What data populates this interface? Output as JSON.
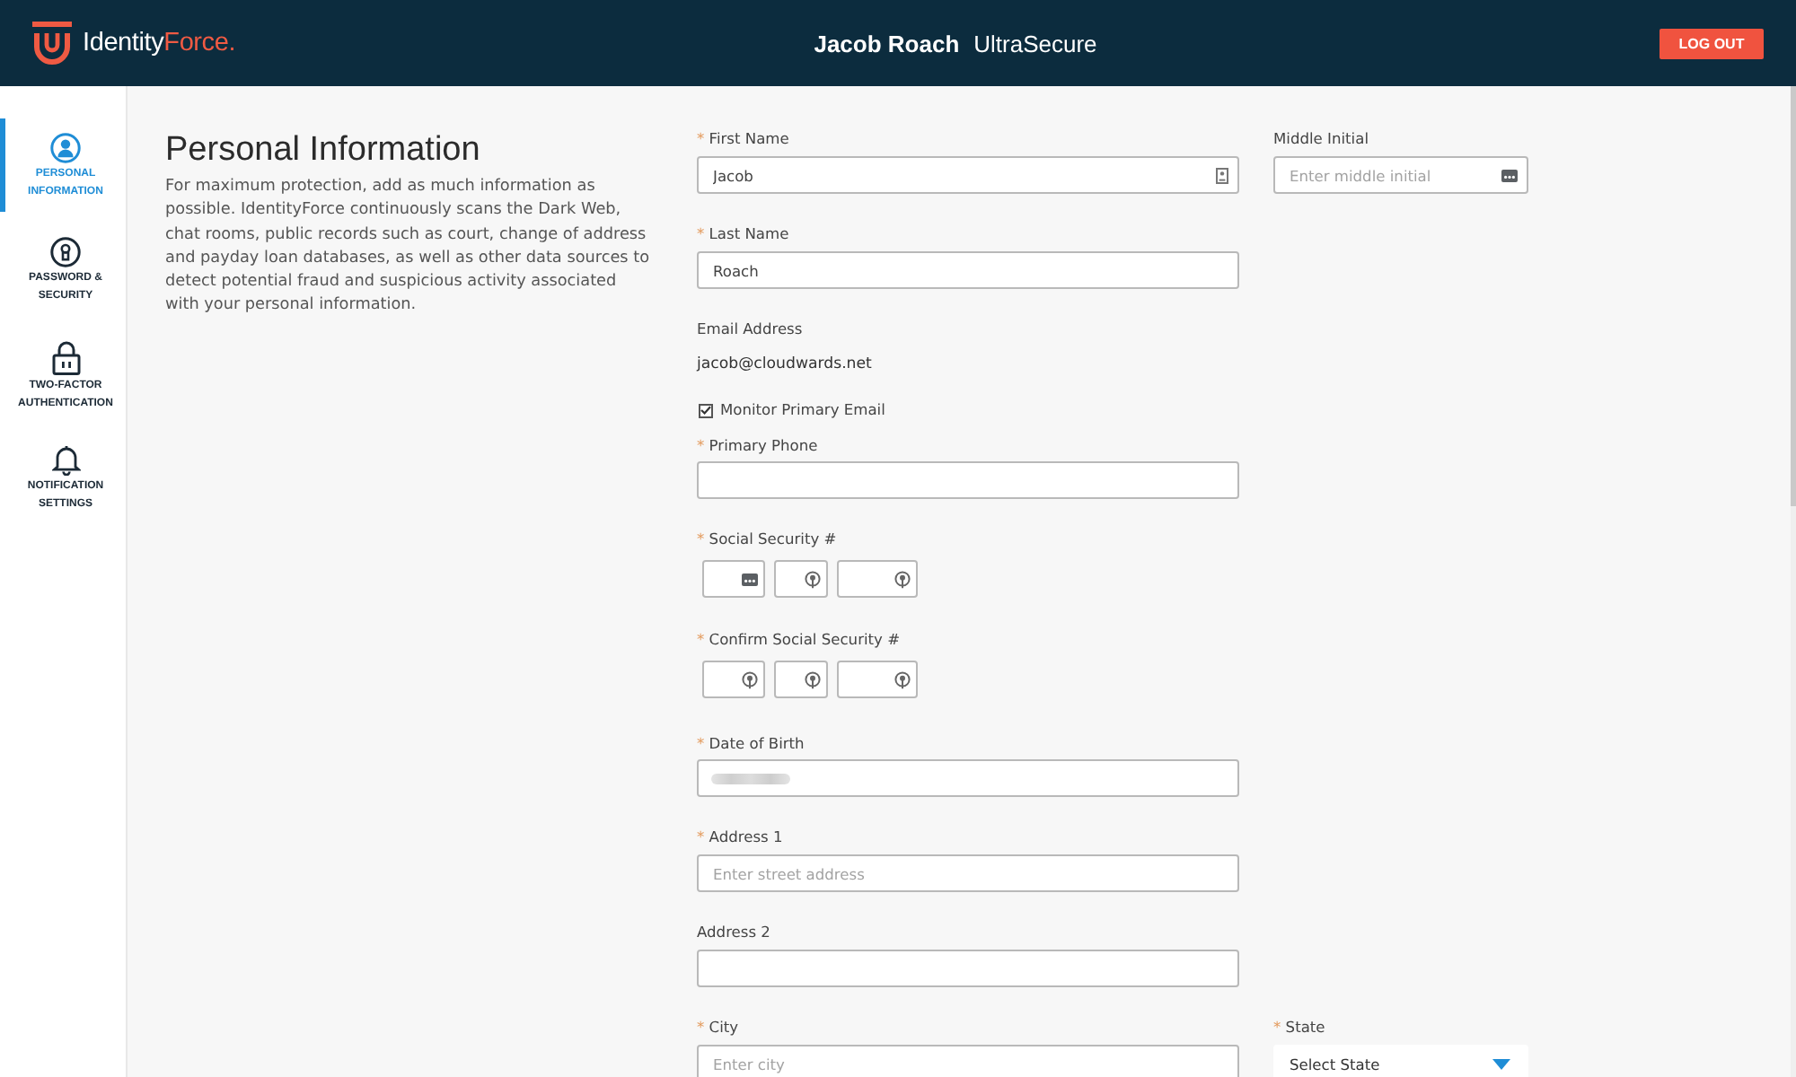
{
  "header": {
    "logo": {
      "text_1": "Identity",
      "text_2": "Force."
    },
    "user_name": "Jacob Roach",
    "plan": "UltraSecure",
    "logout_button": "LOG OUT"
  },
  "sidebar": {
    "items": [
      {
        "label": "PERSONAL INFORMATION",
        "selected": true
      },
      {
        "label": "PASSWORD & SECURITY",
        "selected": false
      },
      {
        "label": "TWO-FACTOR AUTHENTICATION",
        "selected": false
      },
      {
        "label": "NOTIFICATION SETTINGS",
        "selected": false
      }
    ]
  },
  "intro": {
    "title": "Personal Information",
    "text": "For maximum protection, add as much information as possible. IdentityForce continuously scans the Dark Web, chat rooms, public records such as court, change of address and payday loan databases, as well as other data sources to detect potential fraud and suspicious activity associated with your personal information."
  },
  "form": {
    "first_name": {
      "required_mark": "*",
      "label": "First Name",
      "value": "Jacob"
    },
    "middle_initial": {
      "label": "Middle Initial",
      "placeholder": "Enter middle initial"
    },
    "last_name": {
      "required_mark": "*",
      "label": "Last Name",
      "value": "Roach"
    },
    "email": {
      "label": "Email Address",
      "value": "jacob@cloudwards.net"
    },
    "monitor_email": {
      "label": "Monitor Primary Email",
      "checked": true
    },
    "primary_phone": {
      "required_mark": "*",
      "label": "Primary Phone"
    },
    "ssn": {
      "required_mark": "*",
      "label": "Social Security #"
    },
    "confirm_ssn": {
      "required_mark": "*",
      "label": "Confirm Social Security #"
    },
    "date_of_birth": {
      "required_mark": "*",
      "label": "Date of Birth",
      "redacted": true
    },
    "address_1": {
      "required_mark": "*",
      "label": "Address 1",
      "placeholder": "Enter street address"
    },
    "address_2": {
      "label": "Address 2"
    },
    "city": {
      "required_mark": "*",
      "label": "City",
      "placeholder": "Enter city"
    },
    "state": {
      "required_mark": "*",
      "label": "State",
      "placeholder": "Select State"
    }
  }
}
